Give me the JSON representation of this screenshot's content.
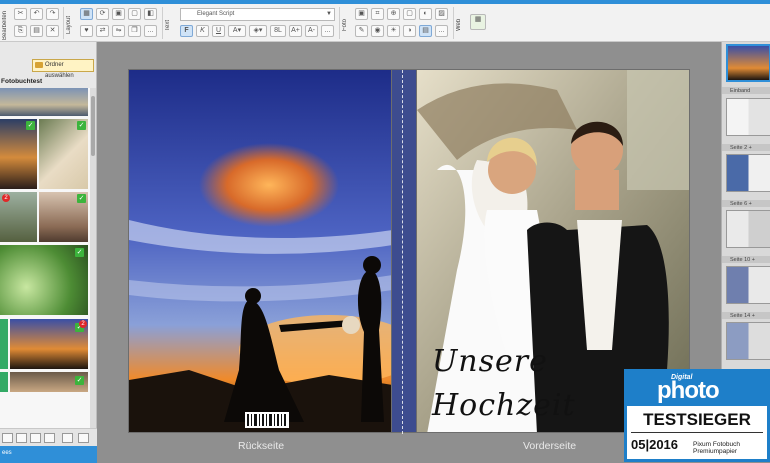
{
  "toolbar": {
    "groups": {
      "edit": "Bearbeiten",
      "layout": "Layout",
      "text": "Text",
      "photo": "Foto",
      "web": "Web"
    },
    "font_name": "Elegant Script",
    "bold": "F",
    "italic": "K",
    "underline": "U",
    "font_size_small": "8L",
    "increase_font": "A+",
    "decrease_font": "A-",
    "more": "..."
  },
  "sidebar": {
    "choose_folder_button": "Ordner auswählen",
    "folder_title": "Fotobuchtest",
    "bottom_label": "ees"
  },
  "canvas": {
    "back_label": "Rückseite",
    "front_label": "Vorderseite",
    "cover_text_line1": "Unsere",
    "cover_text_line2": "Hochzeit"
  },
  "pages_panel": {
    "items": [
      "Einband",
      "Seite 2 +",
      "Seite 6 +",
      "Seite 10 +",
      "Seite 14 +"
    ]
  },
  "badge": {
    "digital": "Digital",
    "brand": "photo",
    "title": "TESTSIEGER",
    "date": "05|2016",
    "description": "Pixum Fotobuch Premiumpapier"
  },
  "colors": {
    "accent": "#2f8fd8",
    "sunset_sky": "#3f4fa8",
    "brand_blue": "#1e7fc9"
  }
}
